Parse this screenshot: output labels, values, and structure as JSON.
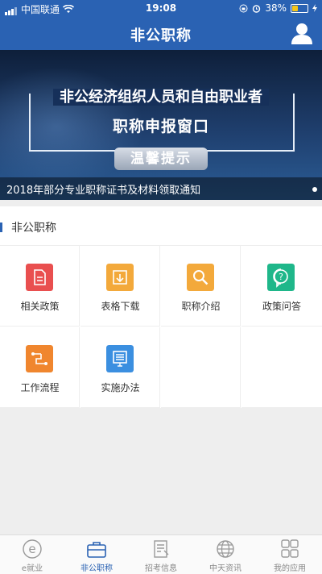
{
  "status": {
    "carrier": "中国联通",
    "time": "19:08",
    "battery": "38%"
  },
  "navbar": {
    "title": "非公职称"
  },
  "banner": {
    "line1": "非公经济组织人员和自由职业者",
    "line2": "职称申报窗口",
    "button": "温馨提示",
    "caption": "2018年部分专业职称证书及材料领取通知"
  },
  "section": {
    "title": "非公职称",
    "items": [
      {
        "label": "相关政策",
        "icon": "document-icon",
        "color": "#e94f4f"
      },
      {
        "label": "表格下载",
        "icon": "download-icon",
        "color": "#f3a93b"
      },
      {
        "label": "职称介绍",
        "icon": "search-icon",
        "color": "#f3a93b"
      },
      {
        "label": "政策问答",
        "icon": "question-icon",
        "color": "#1fb78a"
      },
      {
        "label": "工作流程",
        "icon": "flow-icon",
        "color": "#f0862e"
      },
      {
        "label": "实施办法",
        "icon": "list-icon",
        "color": "#3b8fe0"
      }
    ]
  },
  "tabbar": {
    "tabs": [
      {
        "label": "e就业",
        "icon": "e-icon"
      },
      {
        "label": "非公职称",
        "icon": "briefcase-icon",
        "active": true
      },
      {
        "label": "招考信息",
        "icon": "notepad-icon"
      },
      {
        "label": "中天资讯",
        "icon": "globe-icon"
      },
      {
        "label": "我的应用",
        "icon": "apps-icon"
      }
    ]
  }
}
